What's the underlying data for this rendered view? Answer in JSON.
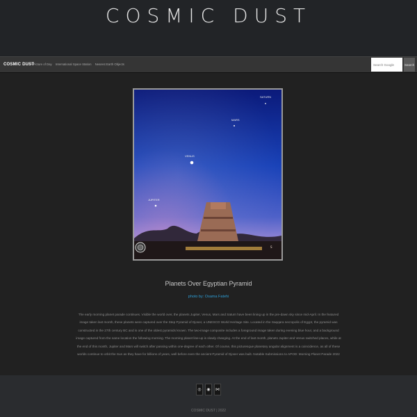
{
  "header": {
    "title": "COSMIC DUST"
  },
  "nav": {
    "brand": "COSMIC DUST",
    "links": [
      "NASA Picture of Day",
      "International Space Station",
      "Nearest Earth Objects"
    ]
  },
  "search": {
    "placeholder": "Search Google",
    "button": "Search"
  },
  "apod": {
    "image_labels": [
      "SATURN",
      "MARS",
      "VENUS",
      "JUPITER"
    ],
    "title": "Planets Over Egyptian Pyramid",
    "credit": "photo by: Osama Fatehi",
    "explanation": "The early morning planet parade continues. Visible the world over, the planets Jupiter, Venus, Mars and Saturn have been lining up in the pre-dawn sky since mid-April. In the featured image taken last month, these planets were captured over the Step Pyramid of Djoser, a UNESCO World Heritage Site. Located in the Saqqara necropolis of Egypt, the pyramid was constructed in the 27th century BC and is one of the oldest pyramids known. The two-image composite includes a foreground image taken during evening blue hour, and a background image captured from the same location the following morning. The morning planet line-up is slowly changing. At the end of last month, planets Jupiter and Venus switched places, while at the end of this month, Jupiter and Mars will switch after passing within one-degree of each other. Of course, this picturesque planetary angular alignment is a coincidence, as all of these worlds continue to orbit the Sun as they have for billions of years, well before even the ancient Pyramid of Djoser was built. Notable Submissions to APOD: Morning Planet Parade 2022"
  },
  "footer": {
    "social_icons": [
      "instagram-icon",
      "globe-icon",
      "medium-icon"
    ],
    "copyright": "COSMIC DUST | 2022"
  },
  "colors": {
    "link": "#2e9ed6",
    "background": "#1f2124",
    "nav": "#353535"
  }
}
